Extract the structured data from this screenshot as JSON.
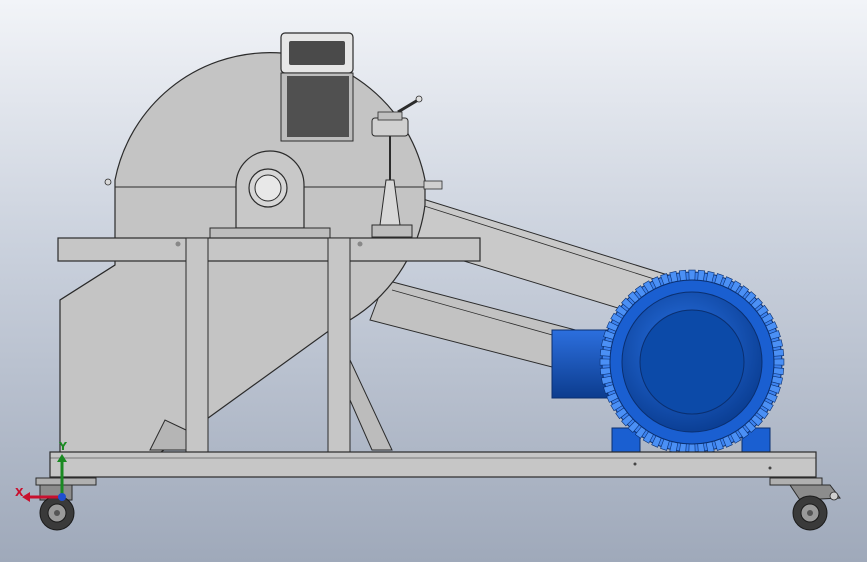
{
  "scene": {
    "subject": "wood-crusher-machine-cad-side-view",
    "colors": {
      "background_top": "#f2f4f8",
      "background_bottom": "#9fa9ba",
      "steel": "#c4c4c4",
      "steel_dark": "#a6a6a6",
      "outline": "#2b2b2b",
      "motor_blue": "#1a5fd1",
      "motor_blue_dark": "#0b3f95",
      "motor_blue_light": "#3d83f0"
    }
  },
  "triad": {
    "x_label": "X",
    "y_label": "Y",
    "x_color": "#c8102e",
    "y_color": "#1a8a22",
    "z_color": "#1f4fd0"
  }
}
